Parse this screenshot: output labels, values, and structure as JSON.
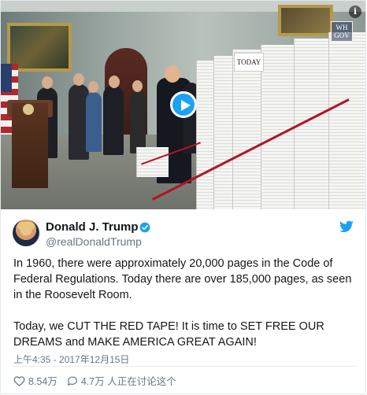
{
  "media": {
    "sign_text": "TODAY",
    "badge_line1": "WH",
    "badge_line2": "GOV",
    "info_glyph": "i",
    "play_icon": "play-icon"
  },
  "tweet": {
    "display_name": "Donald J. Trump",
    "handle": "@realDonaldTrump",
    "verified_icon": "verified-badge-icon",
    "brand_icon": "twitter-bird-icon",
    "brand_color": "#1da1f2",
    "text": "In 1960, there were approximately 20,000 pages in the Code of Federal Regulations. Today there are over 185,000 pages, as seen in the Roosevelt Room.\n\nToday, we CUT THE RED TAPE! It is time to SET FREE OUR DREAMS and MAKE AMERICA GREAT AGAIN!",
    "timestamp": "上午4:35 - 2017年12月15日",
    "likes": "8.54万",
    "replies": "4.7万 人正在讨论这个"
  }
}
